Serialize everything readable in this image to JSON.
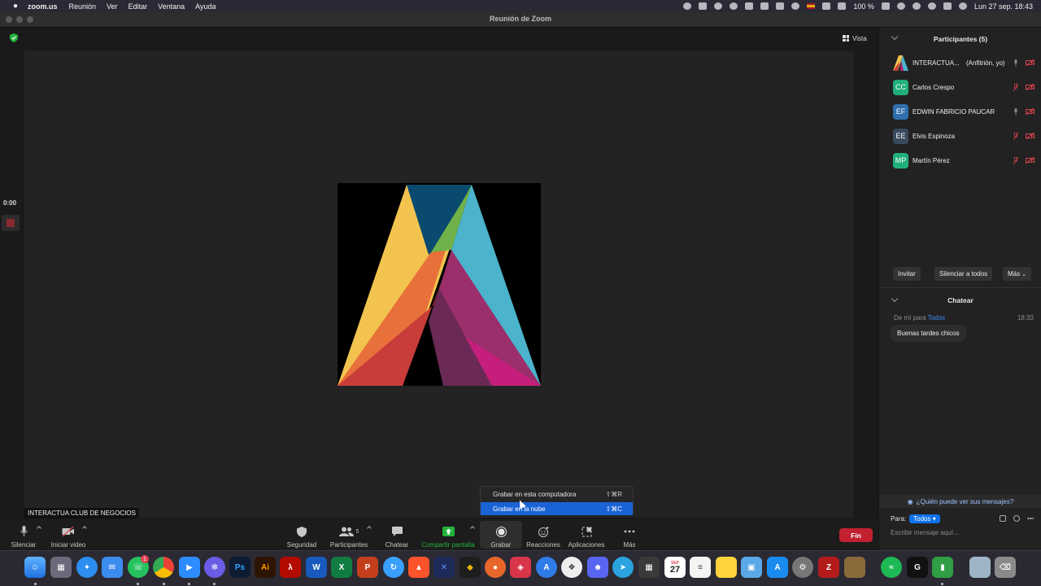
{
  "menubar": {
    "apple": "",
    "app_name": "zoom.us",
    "menus": [
      "Reunión",
      "Ver",
      "Editar",
      "Ventana",
      "Ayuda"
    ],
    "battery": "100 %",
    "datetime": "Lun 27 sep.  18:43"
  },
  "window": {
    "title": "Reunión de Zoom"
  },
  "stage": {
    "view_label": "Vista",
    "timer": "0:00",
    "speaker_name": "INTERACTUA CLUB DE NEGOCIOS"
  },
  "participants": {
    "title": "Participantes (5)",
    "list": [
      {
        "name": "INTERACTUA...",
        "role": "(Anfitrión, yo)",
        "initials": "",
        "color": "",
        "mic": "on",
        "cam": "off"
      },
      {
        "name": "Carlos Crespo",
        "role": "",
        "initials": "CC",
        "color": "#21b07b",
        "mic": "off",
        "cam": "off"
      },
      {
        "name": "EDWIN FABRICIO PAUCAR",
        "role": "",
        "initials": "EF",
        "color": "#2f6fae",
        "mic": "on",
        "cam": "off"
      },
      {
        "name": "Elvis Espinoza",
        "role": "",
        "initials": "EE",
        "color": "#3a4a5e",
        "mic": "off",
        "cam": "off"
      },
      {
        "name": "Martín Pérez",
        "role": "",
        "initials": "MP",
        "color": "#21b07b",
        "mic": "off",
        "cam": "off"
      }
    ],
    "invite_label": "Invitar",
    "mute_all_label": "Silenciar a todos",
    "more_label": "Más"
  },
  "chat": {
    "title": "Chatear",
    "from": "De mí para",
    "to": "Todos",
    "time": "18:33",
    "message": "Buenas tardes chicos",
    "who_can_see": "¿Quién puede ver sus mensajes?",
    "to_label": "Para:",
    "to_select": "Todos",
    "input_placeholder": "Escribir mensaje aquí..."
  },
  "toolbar": {
    "mute": "Silenciar",
    "video": "Iniciar video",
    "security": "Seguridad",
    "participants": "Participantes",
    "participants_count": "5",
    "chat": "Chatear",
    "share": "Compartir pantalla",
    "record": "Grabar",
    "reactions": "Reacciones",
    "apps": "Aplicaciones",
    "more": "Más",
    "end": "Fin"
  },
  "record_menu": {
    "items": [
      {
        "label": "Grabar en esta computadora",
        "shortcut": "⇧⌘R"
      },
      {
        "label": "Grabar en la nube",
        "shortcut": "⇧⌘C"
      }
    ]
  },
  "colors": {
    "accent": "#0e71eb",
    "end": "#c22130",
    "share_green": "#22b33a",
    "muted_red": "#e0424f"
  },
  "dock": {
    "calendar_month": "SEP",
    "calendar_day": "27",
    "whatsapp_badge": "1"
  }
}
